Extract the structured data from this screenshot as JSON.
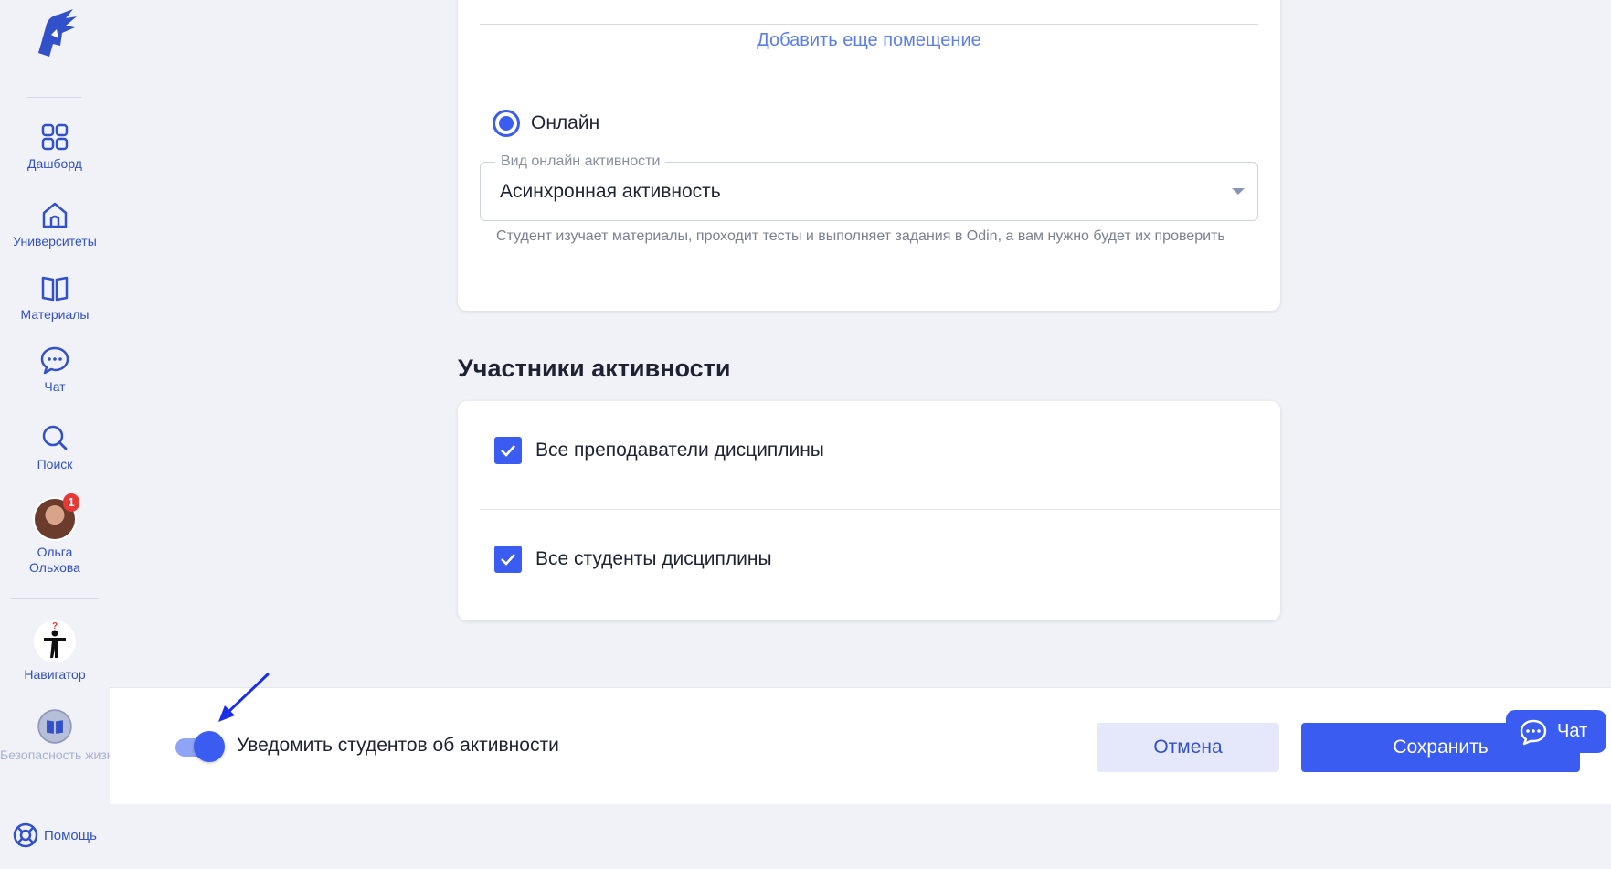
{
  "sidebar": {
    "items": [
      {
        "label": "Дашборд",
        "icon": "grid-icon"
      },
      {
        "label": "Университеты",
        "icon": "house-icon"
      },
      {
        "label": "Материалы",
        "icon": "book-icon"
      },
      {
        "label": "Чат",
        "icon": "chat-bubble-icon"
      },
      {
        "label": "Поиск",
        "icon": "search-icon"
      }
    ],
    "user": {
      "name": "Ольга Ольхова",
      "badge": "1"
    },
    "navigator": {
      "label": "Навигатор"
    },
    "course": {
      "label": "Безопасность жизнедеятельн"
    },
    "help": {
      "label": "Помощь"
    }
  },
  "location": {
    "add_room": "Добавить еще помещение",
    "online_label": "Онлайн",
    "online_selected": true,
    "activity_type": {
      "legend": "Вид онлайн активности",
      "value": "Асинхронная активность",
      "helper": "Студент изучает материалы, проходит тесты и выполняет задания в Odin, а вам нужно будет их проверить"
    }
  },
  "participants": {
    "title": "Участники активности",
    "options": [
      {
        "label": "Все преподаватели дисциплины",
        "checked": true
      },
      {
        "label": "Все студенты дисциплины",
        "checked": true
      }
    ]
  },
  "footer": {
    "notify_label": "Уведомить студентов об активности",
    "notify_on": true,
    "cancel": "Отмена",
    "save": "Сохранить"
  },
  "chat_widget": {
    "label": "Чат"
  },
  "colors": {
    "accent": "#3a5cf0",
    "sidebar_text": "#3150c9",
    "background": "#f0f2f7"
  }
}
